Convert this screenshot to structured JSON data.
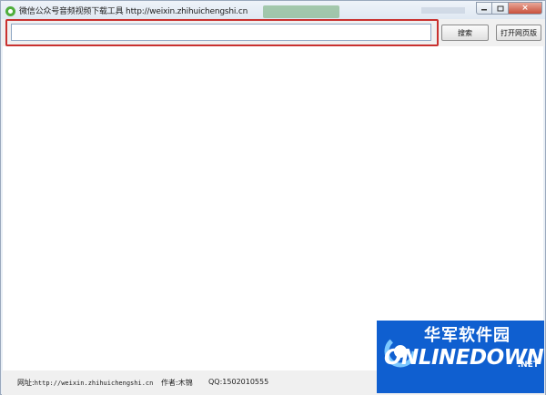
{
  "window": {
    "title": "微信公众号音频视频下载工具 http://weixin.zhihuichengshi.cn",
    "close_label": "×"
  },
  "toolbar": {
    "search_value": "",
    "search_placeholder": "",
    "search_button_label": "搜索",
    "open_page_button_label": "打开网页版"
  },
  "status_bar": {
    "url_label": "网址:",
    "url_value": "http://weixin.zhihuichengshi.cn",
    "author_label": "作者:",
    "author_value": "木锦",
    "qq_label": "QQ:",
    "qq_value": "1502010555"
  },
  "watermark": {
    "chinese_text": "华军软件园",
    "english_text": "ONLINEDOWN",
    "suffix": ".NET"
  },
  "colors": {
    "highlight_border": "#c9312f",
    "watermark_background": "#0f5fd0",
    "title_bar": "#dfe8f2"
  },
  "icons": [
    "app-logo-icon",
    "minimize-icon",
    "maximize-icon",
    "close-icon"
  ]
}
